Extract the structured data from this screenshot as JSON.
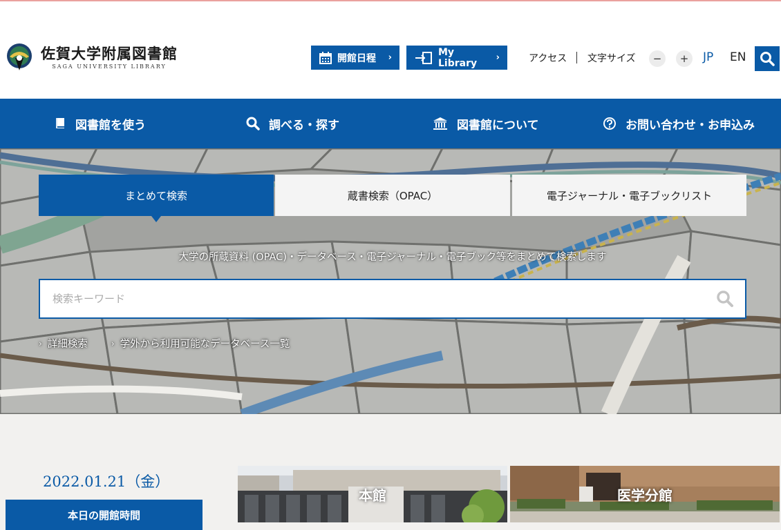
{
  "header": {
    "logo_jp": "佐賀大学附属図書館",
    "logo_en": "SAGA UNIVERSITY LIBRARY",
    "calendar_label": "開館日程",
    "mylibrary_label": "My Library",
    "access_label": "アクセス",
    "font_size_label": "文字サイズ",
    "minus_label": "−",
    "plus_label": "+",
    "lang_jp": "JP",
    "lang_en": "EN",
    "accent_color": "#0a5aa6"
  },
  "nav": {
    "items": [
      {
        "label": "図書館を使う",
        "icon": "book-icon"
      },
      {
        "label": "調べる・探す",
        "icon": "search-icon"
      },
      {
        "label": "図書館について",
        "icon": "library-building-icon"
      },
      {
        "label": "お問い合わせ・お申込み",
        "icon": "question-circle-icon"
      }
    ]
  },
  "search": {
    "tabs": [
      {
        "label": "まとめて検索",
        "active": true
      },
      {
        "label": "蔵書検索（OPAC）",
        "active": false
      },
      {
        "label": "電子ジャーナル・電子ブックリスト",
        "active": false
      }
    ],
    "description": "大学の所蔵資料 (OPAC)・データベース・電子ジャーナル・電子ブック等をまとめて検索します",
    "placeholder": "検索キーワード",
    "value": "",
    "links": [
      {
        "label": "詳細検索"
      },
      {
        "label": "学外から利用可能なデータベース一覧"
      }
    ]
  },
  "info": {
    "date": "2022.01.21（金）",
    "today_hours_label": "本日の開館時間",
    "branches": [
      {
        "label": "本館"
      },
      {
        "label": "医学分館"
      }
    ]
  }
}
